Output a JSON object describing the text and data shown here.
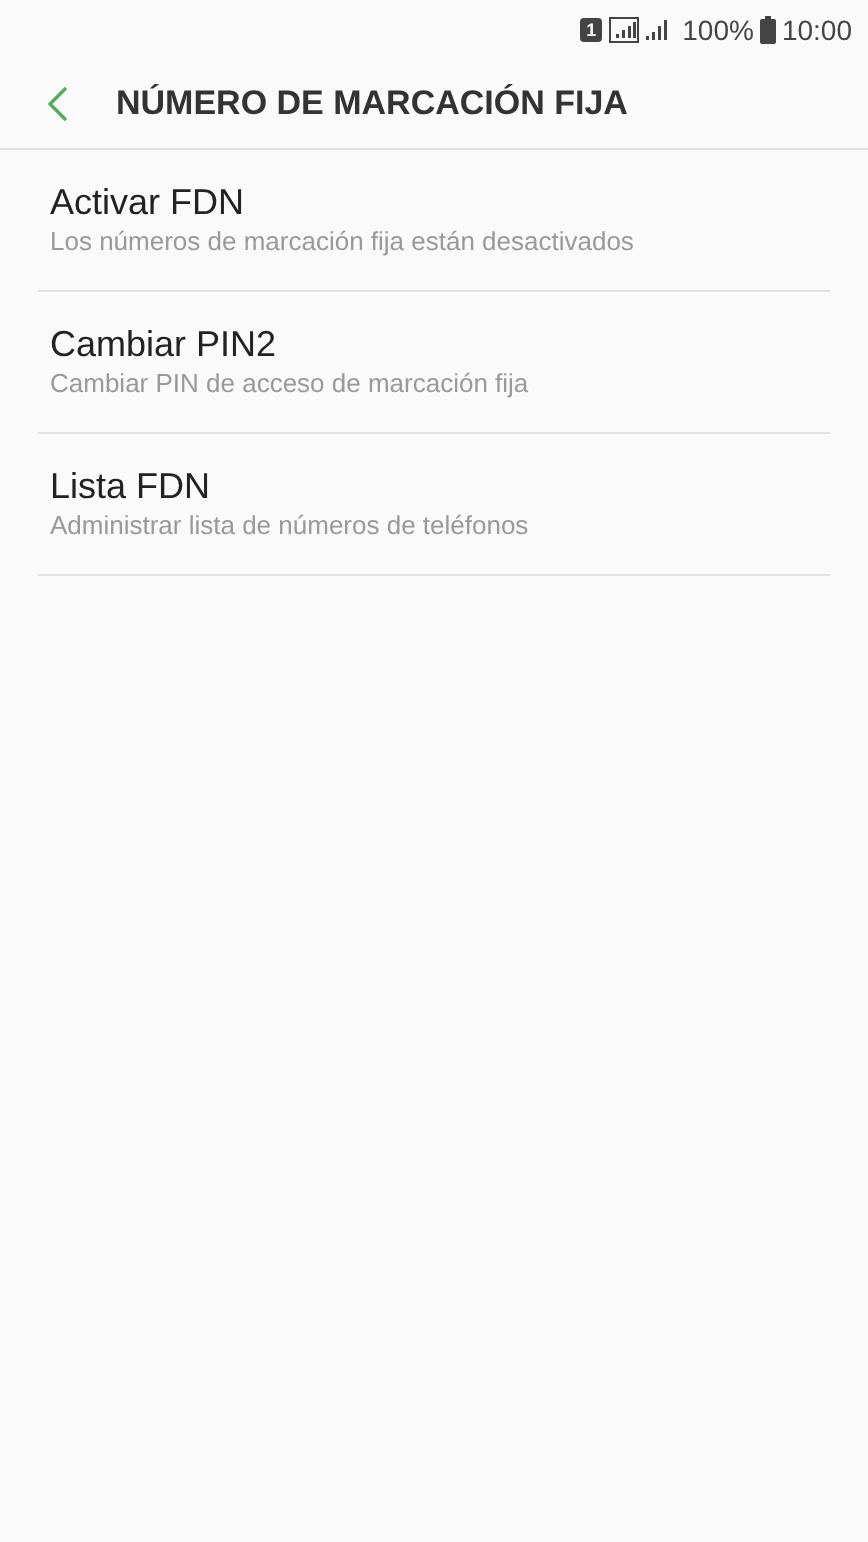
{
  "status_bar": {
    "sim_slot": "1",
    "battery": "100%",
    "time": "10:00"
  },
  "header": {
    "title": "NÚMERO DE MARCACIÓN FIJA"
  },
  "items": [
    {
      "title": "Activar FDN",
      "subtitle": "Los números de marcación fija están desactivados"
    },
    {
      "title": "Cambiar PIN2",
      "subtitle": "Cambiar PIN de acceso de marcación fija"
    },
    {
      "title": "Lista FDN",
      "subtitle": "Administrar lista de números de teléfonos"
    }
  ]
}
